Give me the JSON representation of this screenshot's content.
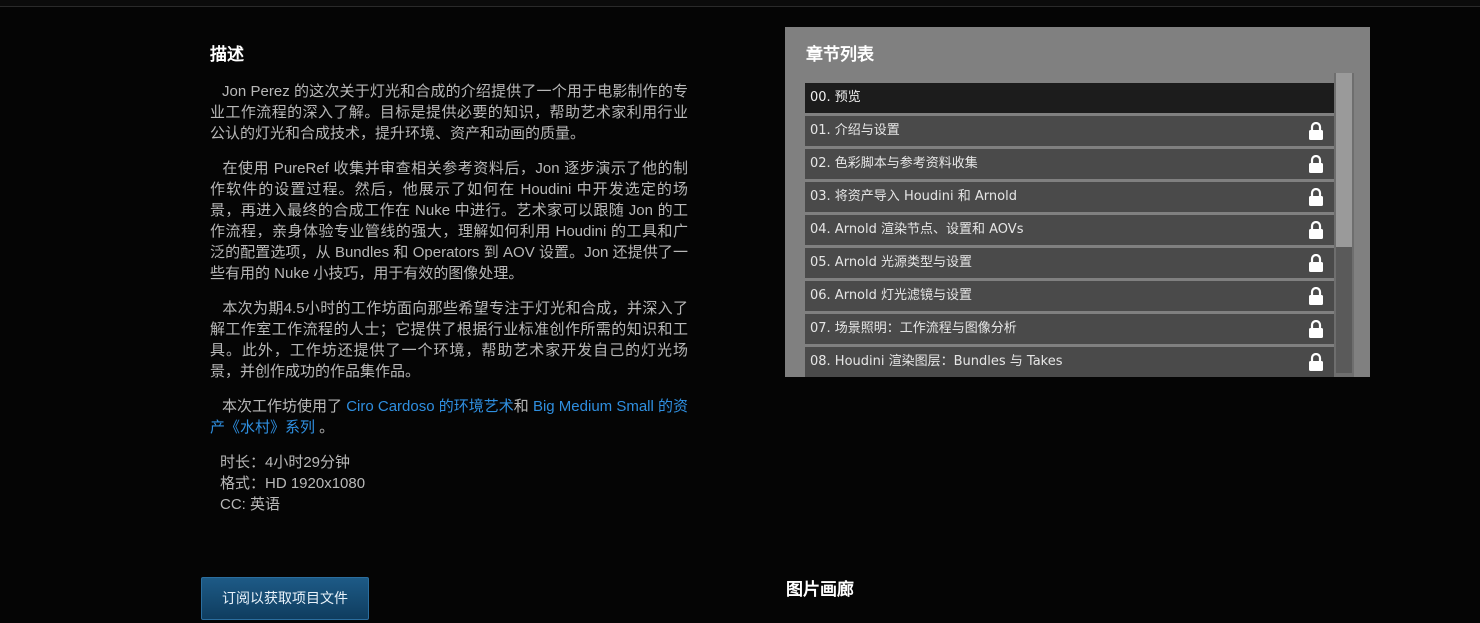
{
  "description": {
    "title": "描述",
    "paragraphs": [
      "Jon Perez 的这次关于灯光和合成的介绍提供了一个用于电影制作的专业工作流程的深入了解。目标是提供必要的知识，帮助艺术家利用行业公认的灯光和合成技术，提升环境、资产和动画的质量。",
      "在使用 PureRef 收集并审查相关参考资料后，Jon 逐步演示了他的制作软件的设置过程。然后，他展示了如何在 Houdini 中开发选定的场景，再进入最终的合成工作在 Nuke 中进行。艺术家可以跟随 Jon 的工作流程，亲身体验专业管线的强大，理解如何利用 Houdini 的工具和广泛的配置选项，从 Bundles 和 Operators 到 AOV 设置。Jon 还提供了一些有用的 Nuke 小技巧，用于有效的图像处理。",
      "本次为期4.5小时的工作坊面向那些希望专注于灯光和合成，并深入了解工作室工作流程的人士；它提供了根据行业标准创作所需的知识和工具。此外，工作坊还提供了一个环境，帮助艺术家开发自己的灯光场景，并创作成功的作品集作品。"
    ],
    "workshop_prefix": "本次工作坊使用了 ",
    "link1": "Ciro Cardoso 的环境艺术",
    "workshop_and": "和 ",
    "link2": "Big Medium Small 的资产《水村》系列",
    "workshop_suffix": " 。",
    "duration": "时长：4小时29分钟",
    "format": "格式：HD 1920x1080",
    "cc": "CC: 英语"
  },
  "chapters": {
    "title": "章节列表",
    "items": [
      {
        "label": "00. 预览",
        "locked": false
      },
      {
        "label": "01. 介绍与设置",
        "locked": true
      },
      {
        "label": "02. 色彩脚本与参考资料收集",
        "locked": true
      },
      {
        "label": "03. 将资产导入 Houdini 和 Arnold",
        "locked": true
      },
      {
        "label": "04. Arnold 渲染节点、设置和 AOVs",
        "locked": true
      },
      {
        "label": "05. Arnold 光源类型与设置",
        "locked": true
      },
      {
        "label": "06. Arnold 灯光滤镜与设置",
        "locked": true
      },
      {
        "label": "07. 场景照明：工作流程与图像分析",
        "locked": true
      },
      {
        "label": "08. Houdini 渲染图层：Bundles 与 Takes",
        "locked": true
      }
    ]
  },
  "subscribe_button": "订阅以获取项目文件",
  "gallery_title": "图片画廊",
  "colors": {
    "link": "#2f8fe0",
    "chapter_panel": "#808080",
    "button": "#1d5a86"
  }
}
